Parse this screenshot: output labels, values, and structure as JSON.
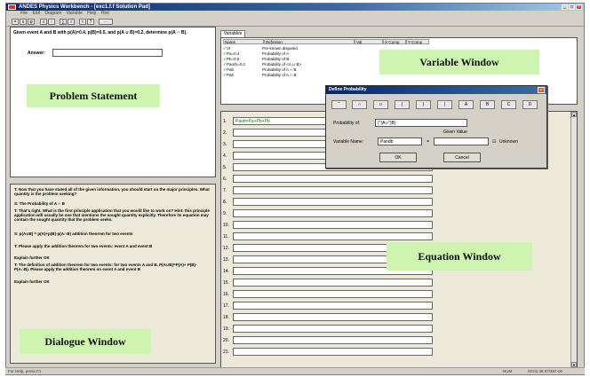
{
  "window": {
    "title": "ANDES Physics Workbench - [exc1.f.f Solution Pad]",
    "buttons": [
      "_",
      "□",
      "×"
    ]
  },
  "menu": [
    "File",
    "Edit",
    "Diagram",
    "Variable",
    "Help",
    "Hint"
  ],
  "toolbar": {
    "buttons": [
      "=",
      "x",
      "φ",
      "ℓ",
      "↑",
      "∑",
      "√",
      "≈",
      "?",
      "⋯"
    ]
  },
  "problem": {
    "question": "Given event A and B with p(A)=0.4, p(B)=0.5, and p(A ∪ B)=0.2, determine p(A ∩ B).",
    "answer_label": "Answer:",
    "answer_value": ""
  },
  "labels": {
    "problem_statement": "Problem Statement",
    "variable_window": "Variable Window",
    "equation_window": "Equation Window",
    "dialogue_window": "Dialogue Window"
  },
  "dialogue": {
    "lines": [
      "T: Now that you have stated all of the given information, you should start on the major principles.  What quantity is the problem seeking?",
      "S: The   Probability of A ∩ B",
      "T: That's right.  What is the first principle application that you would like to work on?  Hint: this principle application will usually be one that mentions the sought quantity explicitly.  Therefore its equation may contain the sought quantity that the problem seeks.",
      "S: p(A∪B) = p(A)+p(B)-p(A∩B)           addition theorem for two events",
      "T: Please apply the addition theorem for two events: event A and event B",
      "         Explain further    OK",
      "T: The definition of addition theorem for two events: for two events A and B,  P(A∪B)=P(A)+ P(B)- P(A∩B). Please apply the addition theorem on event A and event B",
      "         Explain further    OK"
    ]
  },
  "variables": {
    "tab": "Variables",
    "headers": [
      "Name",
      "Definition",
      "Val",
      "X-Comp",
      "Y-Comp"
    ],
    "rows": [
      {
        "name": "Vt",
        "def": "Pre-known disputed"
      },
      {
        "name": "Pa=0.4",
        "def": "Probability of A"
      },
      {
        "name": "Pb=0.5",
        "def": "Probability of B"
      },
      {
        "name": "Paorb=0.2",
        "def": "Probability of <A ∪ B>"
      },
      {
        "name": "Pab",
        "def": "Probability of A ∩ B"
      },
      {
        "name": "Pab",
        "def": "Probability of A ∩ B"
      }
    ]
  },
  "equations": {
    "rows": [
      {
        "num": "1.",
        "text": "Paob=Pa+Pb+Pb"
      },
      {
        "num": "2.",
        "text": ""
      },
      {
        "num": "3.",
        "text": ""
      },
      {
        "num": "4.",
        "text": ""
      },
      {
        "num": "5.",
        "text": ""
      },
      {
        "num": "6.",
        "text": ""
      },
      {
        "num": "7.",
        "text": ""
      },
      {
        "num": "8.",
        "text": ""
      },
      {
        "num": "9.",
        "text": ""
      },
      {
        "num": "10.",
        "text": ""
      },
      {
        "num": "11.",
        "text": ""
      },
      {
        "num": "12.",
        "text": ""
      },
      {
        "num": "13.",
        "text": ""
      },
      {
        "num": "14.",
        "text": ""
      },
      {
        "num": "15.",
        "text": ""
      },
      {
        "num": "16.",
        "text": ""
      },
      {
        "num": "17.",
        "text": ""
      },
      {
        "num": "18.",
        "text": ""
      },
      {
        "num": "19.",
        "text": ""
      },
      {
        "num": "20.",
        "text": ""
      },
      {
        "num": "21.",
        "text": ""
      }
    ]
  },
  "modal": {
    "title": "Define Probability",
    "symbols": [
      "˜",
      "∩",
      "∪",
      "(",
      ")",
      "|",
      "A",
      "B",
      "C",
      "D"
    ],
    "prob_label": "Probability of:",
    "prob_value": "(\"(A∪\")B)",
    "given_label": "Given Value",
    "varname_label": "Variable Name:",
    "varname_value": "Pandb",
    "equals": "=",
    "unknown_label": "Unknown",
    "ok": "OK",
    "cancel": "Cancel"
  },
  "status": {
    "left": "For Help, press F1",
    "mid": "NUM",
    "right": "00:01:48   97/387-00"
  }
}
